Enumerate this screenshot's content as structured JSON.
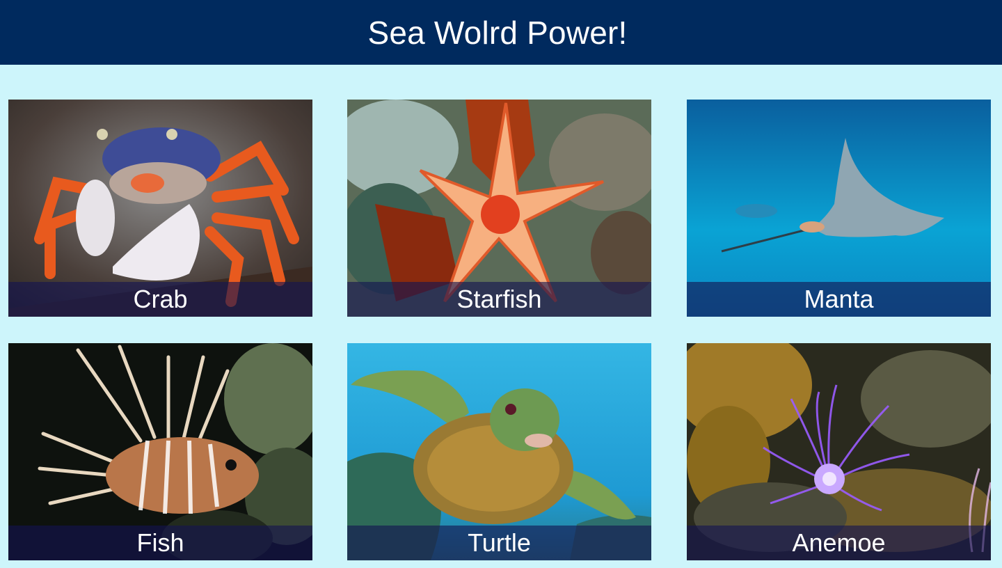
{
  "header": {
    "title": "Sea Wolrd Power!"
  },
  "colors": {
    "header_bg": "#002a5e",
    "page_bg": "#cdf5fb",
    "caption_bg": "rgba(20,20,80,0.62)"
  },
  "cards": [
    {
      "label": "Crab",
      "image": "crab-photo"
    },
    {
      "label": "Starfish",
      "image": "starfish-photo"
    },
    {
      "label": "Manta",
      "image": "manta-ray-photo"
    },
    {
      "label": "Fish",
      "image": "lionfish-photo"
    },
    {
      "label": "Turtle",
      "image": "sea-turtle-photo"
    },
    {
      "label": "Anemoe",
      "image": "anemone-photo"
    }
  ]
}
